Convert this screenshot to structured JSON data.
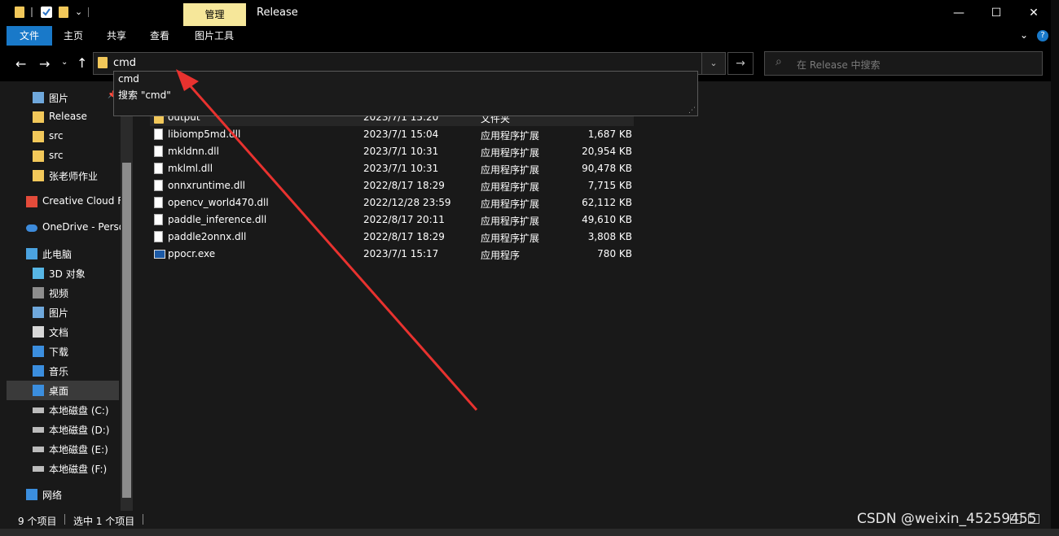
{
  "window": {
    "title": "Release",
    "context_tab": "管理",
    "controls": {
      "minimize": "—",
      "maximize": "☐",
      "close": "✕"
    }
  },
  "ribbon": {
    "tabs": [
      "文件",
      "主页",
      "共享",
      "查看",
      "图片工具"
    ],
    "expand": "⌄",
    "help": "?"
  },
  "nav": {
    "back": "←",
    "forward": "→",
    "recent": "⌄",
    "up": "↑",
    "address_value": "cmd",
    "dropdown": "⌄",
    "go": "→",
    "search_placeholder": "在 Release 中搜索",
    "search_icon": "⌕"
  },
  "autocomplete": {
    "items": [
      "cmd",
      "搜索 \"cmd\""
    ]
  },
  "sidebar": {
    "items": [
      {
        "label": "图片",
        "icon": "pictures-icon",
        "pin": "📌"
      },
      {
        "label": "Release",
        "icon": "folder-icon"
      },
      {
        "label": "src",
        "icon": "folder-icon"
      },
      {
        "label": "src",
        "icon": "folder-icon"
      },
      {
        "label": "张老师作业",
        "icon": "folder-icon"
      },
      {
        "label": "Creative Cloud F",
        "icon": "creative-cloud-icon"
      },
      {
        "label": "OneDrive - Perso",
        "icon": "onedrive-icon"
      },
      {
        "label": "此电脑",
        "icon": "computer-icon"
      },
      {
        "label": "3D 对象",
        "icon": "3d-objects-icon"
      },
      {
        "label": "视频",
        "icon": "videos-icon"
      },
      {
        "label": "图片",
        "icon": "pictures-icon"
      },
      {
        "label": "文档",
        "icon": "documents-icon"
      },
      {
        "label": "下载",
        "icon": "downloads-icon"
      },
      {
        "label": "音乐",
        "icon": "music-icon"
      },
      {
        "label": "桌面",
        "icon": "desktop-icon",
        "selected": true
      },
      {
        "label": "本地磁盘 (C:)",
        "icon": "drive-icon"
      },
      {
        "label": "本地磁盘 (D:)",
        "icon": "drive-icon"
      },
      {
        "label": "本地磁盘 (E:)",
        "icon": "drive-icon"
      },
      {
        "label": "本地磁盘 (F:)",
        "icon": "drive-icon"
      },
      {
        "label": "网络",
        "icon": "network-icon"
      }
    ]
  },
  "files": [
    {
      "name": "output",
      "date": "2023/7/1 15:20",
      "type": "文件夹",
      "size": "",
      "icon": "folder-icon"
    },
    {
      "name": "libiomp5md.dll",
      "date": "2023/7/1 15:04",
      "type": "应用程序扩展",
      "size": "1,687 KB",
      "icon": "dll-icon"
    },
    {
      "name": "mkldnn.dll",
      "date": "2023/7/1 10:31",
      "type": "应用程序扩展",
      "size": "20,954 KB",
      "icon": "dll-icon"
    },
    {
      "name": "mklml.dll",
      "date": "2023/7/1 10:31",
      "type": "应用程序扩展",
      "size": "90,478 KB",
      "icon": "dll-icon"
    },
    {
      "name": "onnxruntime.dll",
      "date": "2022/8/17 18:29",
      "type": "应用程序扩展",
      "size": "7,715 KB",
      "icon": "dll-icon"
    },
    {
      "name": "opencv_world470.dll",
      "date": "2022/12/28 23:59",
      "type": "应用程序扩展",
      "size": "62,112 KB",
      "icon": "dll-icon"
    },
    {
      "name": "paddle_inference.dll",
      "date": "2022/8/17 20:11",
      "type": "应用程序扩展",
      "size": "49,610 KB",
      "icon": "dll-icon"
    },
    {
      "name": "paddle2onnx.dll",
      "date": "2022/8/17 18:29",
      "type": "应用程序扩展",
      "size": "3,808 KB",
      "icon": "dll-icon"
    },
    {
      "name": "ppocr.exe",
      "date": "2023/7/1 15:17",
      "type": "应用程序",
      "size": "780 KB",
      "icon": "exe-icon"
    }
  ],
  "status": {
    "count": "9 个项目",
    "selected": "选中 1 个项目"
  },
  "watermark": "CSDN @weixin_45259455",
  "colors": {
    "accent": "#1979c9",
    "context_tab": "#f6e79a",
    "folder": "#f2c85a",
    "arrow": "#e8322f"
  }
}
